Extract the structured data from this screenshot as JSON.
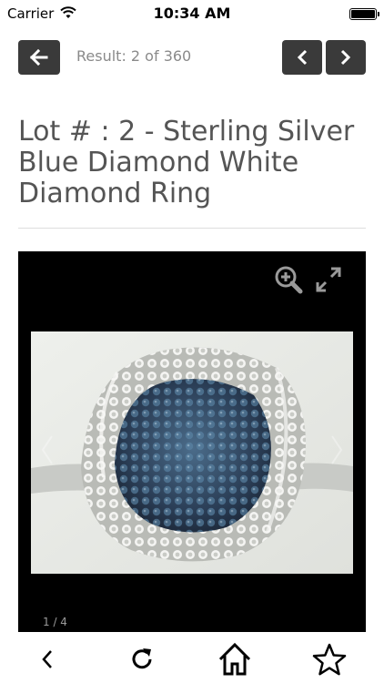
{
  "status_bar": {
    "carrier": "Carrier",
    "time": "10:34 AM",
    "wifi_icon": "wifi-icon",
    "battery_icon": "battery-icon"
  },
  "nav": {
    "back_icon": "arrow-left-icon",
    "result_text": "Result: 2 of 360",
    "prev_icon": "chevron-left-icon",
    "next_icon": "chevron-right-icon"
  },
  "lot": {
    "title": "Lot # : 2 - Sterling Silver Blue Diamond White Diamond Ring"
  },
  "gallery": {
    "counter": "1 / 4",
    "zoom_icon": "zoom-in-icon",
    "expand_icon": "expand-icon",
    "image_subject": "blue and white diamond ring photo"
  },
  "toolbar": {
    "items": [
      "back-icon",
      "refresh-icon",
      "home-icon",
      "star-icon"
    ]
  },
  "colors": {
    "button_bg": "#3a3a3a",
    "title": "#555555",
    "result_text": "#8a8a8a",
    "gallery_bg": "#000000"
  }
}
